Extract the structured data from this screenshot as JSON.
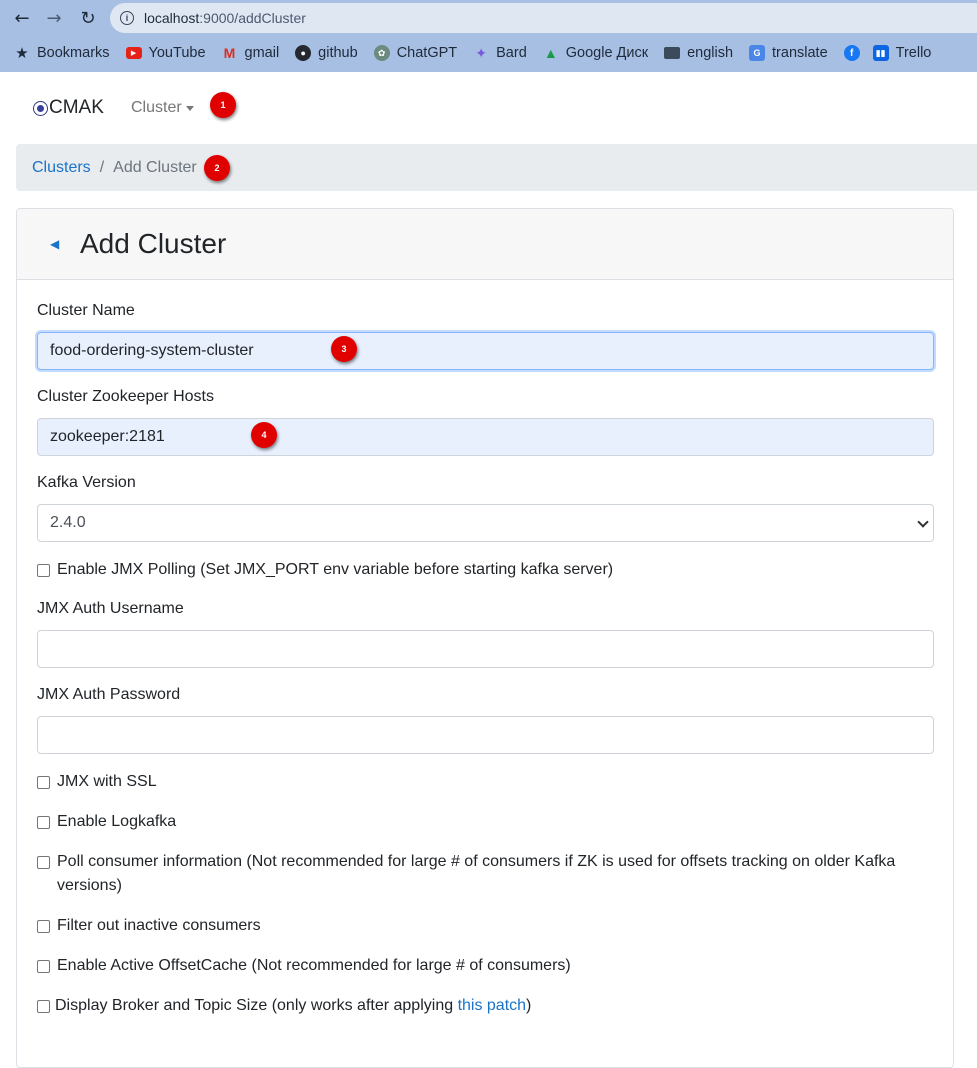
{
  "browser": {
    "url_host": "localhost",
    "url_rest": ":9000/addCluster",
    "bookmarks": [
      {
        "label": "Bookmarks",
        "icon": "star-icon"
      },
      {
        "label": "YouTube",
        "icon": "youtube-icon"
      },
      {
        "label": "gmail",
        "icon": "gmail-icon"
      },
      {
        "label": "github",
        "icon": "github-icon"
      },
      {
        "label": "ChatGPT",
        "icon": "chatgpt-icon"
      },
      {
        "label": "Bard",
        "icon": "bard-icon"
      },
      {
        "label": "Google Диск",
        "icon": "google-drive-icon"
      },
      {
        "label": "english",
        "icon": "folder-icon"
      },
      {
        "label": "translate",
        "icon": "translate-icon"
      },
      {
        "label": "",
        "icon": "facebook-icon"
      },
      {
        "label": "Trello",
        "icon": "trello-icon"
      }
    ]
  },
  "navbar": {
    "brand": "CMAK",
    "cluster_menu": "Cluster"
  },
  "markers": [
    "1",
    "2",
    "3",
    "4"
  ],
  "breadcrumb": {
    "clusters": "Clusters",
    "separator": "/",
    "current": "Add Cluster"
  },
  "card": {
    "title": "Add Cluster",
    "back_icon": "arrow-left-icon"
  },
  "form": {
    "cluster_name_label": "Cluster Name",
    "cluster_name_value": "food-ordering-system-cluster",
    "zk_hosts_label": "Cluster Zookeeper Hosts",
    "zk_hosts_value": "zookeeper:2181",
    "kafka_version_label": "Kafka Version",
    "kafka_version_value": "2.4.0",
    "enable_jmx": "Enable JMX Polling (Set JMX_PORT env variable before starting kafka server)",
    "jmx_user_label": "JMX Auth Username",
    "jmx_user_value": "",
    "jmx_pass_label": "JMX Auth Password",
    "jmx_pass_value": "",
    "jmx_ssl": "JMX with SSL",
    "enable_logkafka": "Enable Logkafka",
    "poll_consumer": "Poll consumer information (Not recommended for large # of consumers if ZK is used for offsets tracking on older Kafka versions)",
    "filter_inactive": "Filter out inactive consumers",
    "active_offset_cache": "Enable Active OffsetCache (Not recommended for large # of consumers)",
    "display_size_prefix": "Display Broker and Topic Size (only works after applying ",
    "display_size_link": "this patch",
    "display_size_suffix": ")"
  },
  "colors": {
    "link": "#1a73c8",
    "marker": "#e00000",
    "browser_bar": "#a7bfe3",
    "autofill_bg": "#e8f0fe"
  }
}
